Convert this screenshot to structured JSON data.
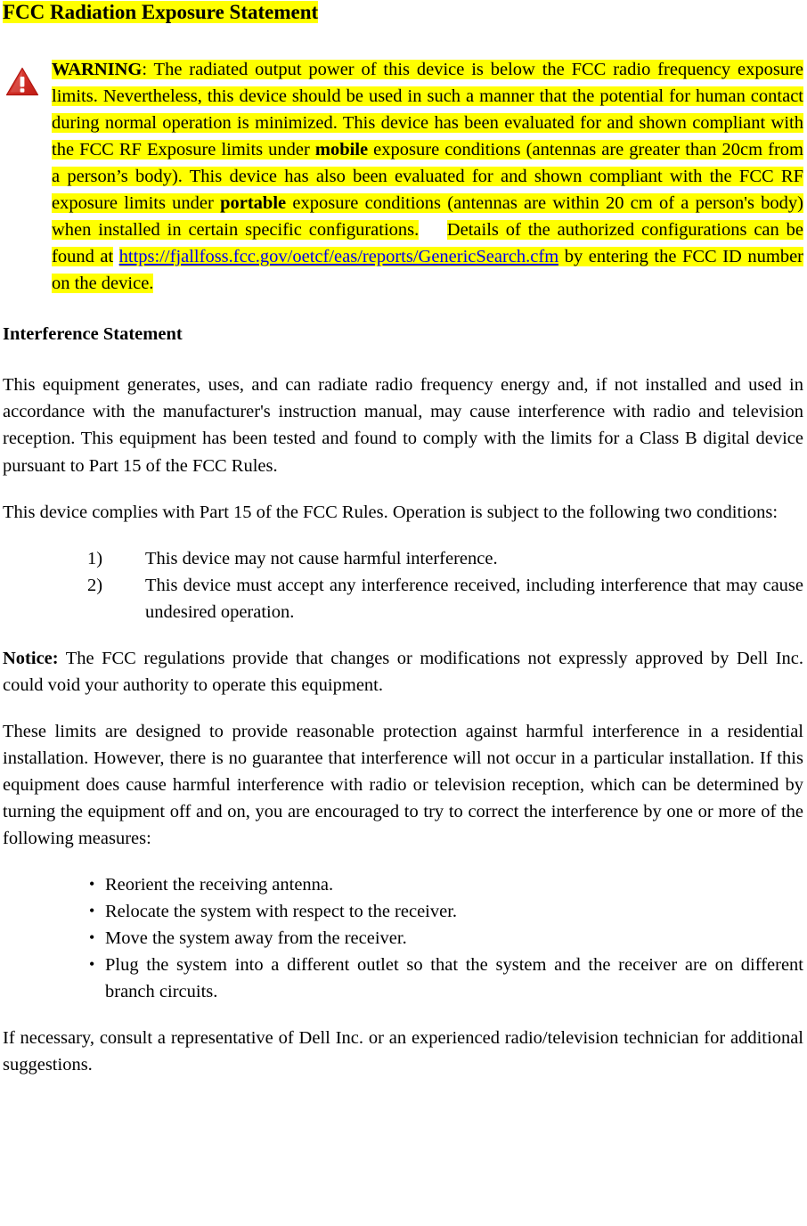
{
  "document": {
    "title": "FCC Radiation Exposure Statement",
    "highlight_color": "#ffff00",
    "warning_icon_color": "#d62020"
  },
  "warning": {
    "icon_name": "warning-triangle-icon",
    "label": "WARNING",
    "label_suffix": ":",
    "text_1": " The radiated output power of this device is below the FCC radio frequency exposure limits. Nevertheless, this device should be used in such a manner that the potential for human contact during normal operation is minimized. This device has been evaluated for and shown compliant with the FCC RF Exposure limits under ",
    "bold_mobile": "mobile",
    "text_2": " exposure conditions (antennas are greater than 20cm from a person’s body). This device has also been evaluated for and shown compliant with the FCC RF exposure limits under ",
    "bold_portable": "portable",
    "text_3": " exposure conditions (antennas are within 20 cm of a person's body) when installed in certain specific configurations.",
    "text_4": "Details of the authorized configurations can be found at",
    "url": "https://fjallfoss.fcc.gov/oetcf/eas/reports/GenericSearch.cfm",
    "text_5": " by entering the FCC ID number on the device."
  },
  "interference": {
    "heading": "Interference Statement",
    "para_1": "This equipment generates, uses, and can radiate radio frequency energy and, if not installed and used in accordance with the manufacturer's instruction manual, may cause interference with radio and television reception. This equipment has been tested and found to comply with the limits for a Class B digital device pursuant to Part 15 of the FCC Rules.",
    "para_2": "This device complies with Part 15 of the FCC Rules. Operation is subject to the following two conditions:",
    "conditions": [
      {
        "marker": "1)",
        "text": "This device may not cause harmful interference."
      },
      {
        "marker": "2)",
        "text": "This device must accept any interference received, including interference that may cause undesired operation."
      }
    ],
    "notice_label": "Notice:",
    "notice_text": " The FCC regulations provide that changes or modifications not expressly approved by Dell Inc. could void your authority to operate this equipment.",
    "para_3": "These limits are designed to provide reasonable protection against harmful interference in a residential installation. However, there is no guarantee that interference will not occur in a particular installation. If this equipment does cause harmful interference with radio or television reception, which can be determined by turning the equipment off and on, you are encouraged to try to correct the interference by one or more of the following measures:",
    "bullet_char": "•",
    "measures": [
      "Reorient the receiving antenna.",
      "Relocate the system with respect to the receiver.",
      "Move the system away from the receiver.",
      "Plug the system into a different outlet so that the system and the receiver are on different branch circuits."
    ],
    "para_4": "If necessary, consult a representative of Dell Inc. or an experienced radio/television technician for additional suggestions."
  }
}
